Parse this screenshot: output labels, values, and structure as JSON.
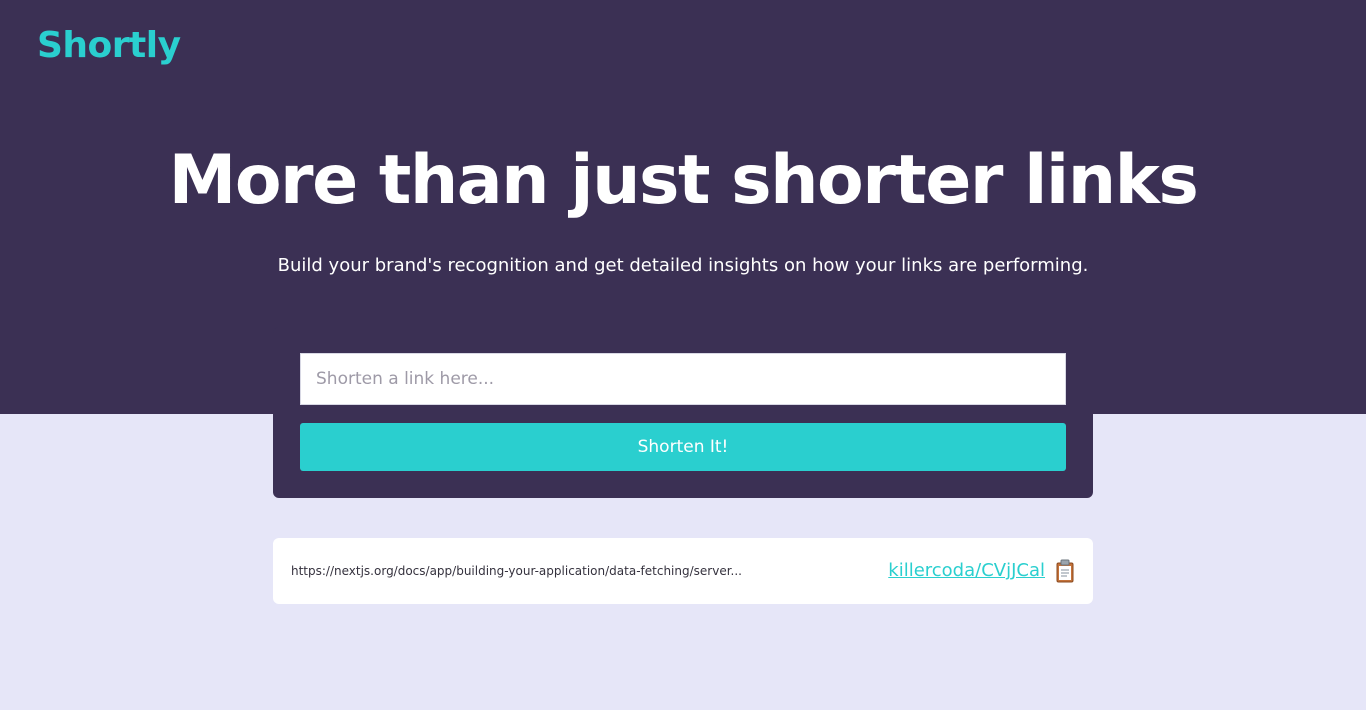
{
  "header": {
    "logo": "Shortly"
  },
  "hero": {
    "headline": "More than just shorter links",
    "subtitle": "Build your brand's recognition and get detailed insights on how your links are performing."
  },
  "form": {
    "input_placeholder": "Shorten a link here...",
    "input_value": "",
    "button_label": "Shorten It!"
  },
  "results": [
    {
      "original_url": "https://nextjs.org/docs/app/building-your-application/data-fetching/server...",
      "short_link": "killercoda/CVjJCal",
      "copy_icon": "clipboard-icon"
    }
  ],
  "colors": {
    "hero_bg": "#3b3054",
    "page_bg": "#e6e6f8",
    "accent": "#2acfcf",
    "white": "#ffffff"
  }
}
